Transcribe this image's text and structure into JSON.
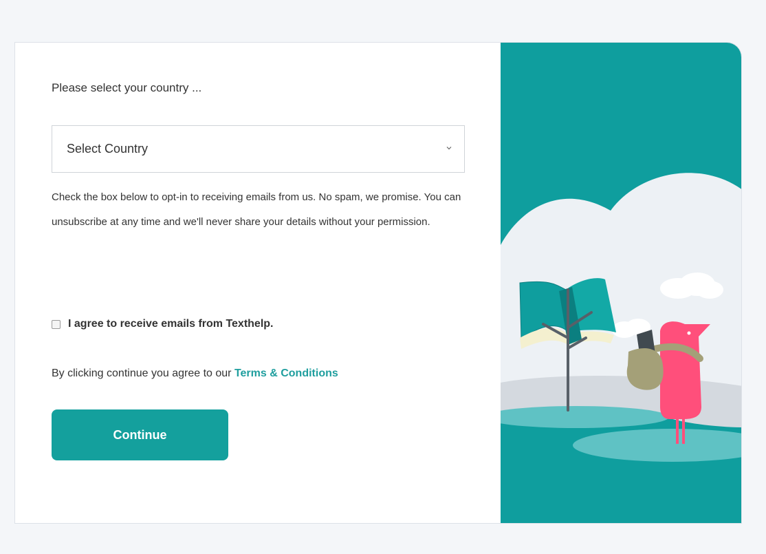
{
  "form": {
    "prompt": "Please select your country ...",
    "country_select": {
      "value": "Select Country"
    },
    "opt_in_text": "Check the box below to opt-in to receiving emails from us. No spam, we promise. You can unsubscribe at any time and we'll never share your details without your permission.",
    "agree_checkbox": {
      "checked": false,
      "label": "I agree to receive emails from Texthelp."
    },
    "terms": {
      "prefix": "By clicking continue you agree to our ",
      "link_label": "Terms & Conditions"
    },
    "continue_label": "Continue"
  },
  "colors": {
    "accent": "#14a09d",
    "link": "#1f9e9e",
    "illustration_bg": "#0f9e9e",
    "bird": "#ff4f7b"
  },
  "icons": {
    "select_arrow": "chevron-down-icon"
  }
}
